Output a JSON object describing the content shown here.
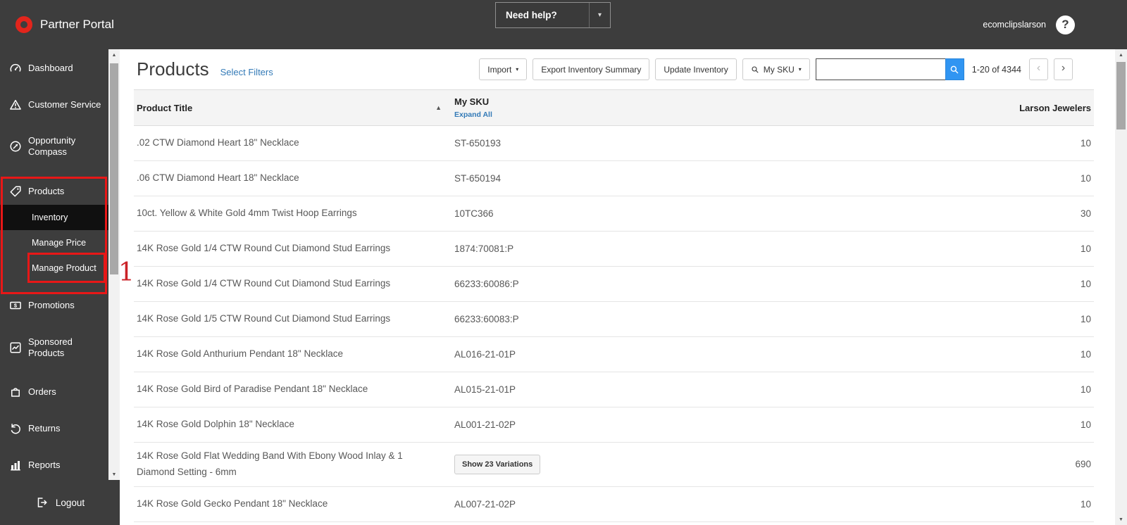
{
  "topbar": {
    "brand": "Partner Portal",
    "help_button": "Need help?",
    "username": "ecomclipslarson"
  },
  "icons": {
    "chevron_down": "▾",
    "caret_down": "▾",
    "sort_asc": "▲",
    "scroll_up": "▲",
    "scroll_down": "▼",
    "prev": "‹",
    "next": "›",
    "help": "?"
  },
  "sidebar": {
    "items": [
      {
        "label": "Dashboard",
        "icon": "gauge-icon"
      },
      {
        "label": "Customer Service",
        "icon": "warning-icon"
      },
      {
        "label": "Opportunity Compass",
        "icon": "compass-icon"
      },
      {
        "label": "Products",
        "icon": "tag-icon"
      },
      {
        "label": "Promotions",
        "icon": "dollar-icon"
      },
      {
        "label": "Sponsored Products",
        "icon": "chart-up-icon"
      },
      {
        "label": "Orders",
        "icon": "bag-icon"
      },
      {
        "label": "Returns",
        "icon": "return-arrow-icon"
      },
      {
        "label": "Reports",
        "icon": "bar-chart-icon"
      }
    ],
    "products_submenu": [
      {
        "label": "Inventory",
        "active": true
      },
      {
        "label": "Manage Price",
        "active": false
      },
      {
        "label": "Manage Product",
        "active": false
      }
    ],
    "logout_label": "Logout"
  },
  "annotations": {
    "step_number": "1"
  },
  "page": {
    "title": "Products",
    "select_filters_link": "Select Filters"
  },
  "toolbar": {
    "import_label": "Import",
    "export_label": "Export Inventory Summary",
    "update_label": "Update Inventory",
    "sku_filter_label": "My SKU",
    "search_value": "",
    "range_text": "1-20 of 4344"
  },
  "table": {
    "columns": {
      "title": "Product Title",
      "sku": "My SKU",
      "sku_expand": "Expand All",
      "qty": "Larson Jewelers"
    },
    "rows": [
      {
        "title": ".02 CTW Diamond Heart 18\" Necklace",
        "sku": "ST-650193",
        "qty": "10"
      },
      {
        "title": ".06 CTW Diamond Heart 18\" Necklace",
        "sku": "ST-650194",
        "qty": "10"
      },
      {
        "title": "10ct. Yellow & White Gold 4mm Twist Hoop Earrings",
        "sku": "10TC366",
        "qty": "30"
      },
      {
        "title": "14K Rose Gold 1/4 CTW Round Cut Diamond Stud Earrings",
        "sku": "1874:70081:P",
        "qty": "10"
      },
      {
        "title": "14K Rose Gold 1/4 CTW Round Cut Diamond Stud Earrings",
        "sku": "66233:60086:P",
        "qty": "10"
      },
      {
        "title": "14K Rose Gold 1/5 CTW Round Cut Diamond Stud Earrings",
        "sku": "66233:60083:P",
        "qty": "10"
      },
      {
        "title": "14K Rose Gold Anthurium Pendant 18\" Necklace",
        "sku": "AL016-21-01P",
        "qty": "10"
      },
      {
        "title": "14K Rose Gold Bird of Paradise Pendant 18\" Necklace",
        "sku": "AL015-21-01P",
        "qty": "10"
      },
      {
        "title": "14K Rose Gold Dolphin 18\" Necklace",
        "sku": "AL001-21-02P",
        "qty": "10"
      },
      {
        "title": "14K Rose Gold Flat Wedding Band With Ebony Wood Inlay & 1 Diamond Setting - 6mm",
        "variations": "Show 23 Variations",
        "qty": "690"
      },
      {
        "title": "14K Rose Gold Gecko Pendant 18\" Necklace",
        "sku": "AL007-21-02P",
        "qty": "10"
      }
    ]
  },
  "colors": {
    "brand_red": "#e2251c",
    "annotation_red": "#e81717",
    "link_blue": "#337ab7",
    "search_button_blue": "#3095f2",
    "sidebar_dark": "#3d3d3d",
    "active_item_black": "#101010"
  }
}
